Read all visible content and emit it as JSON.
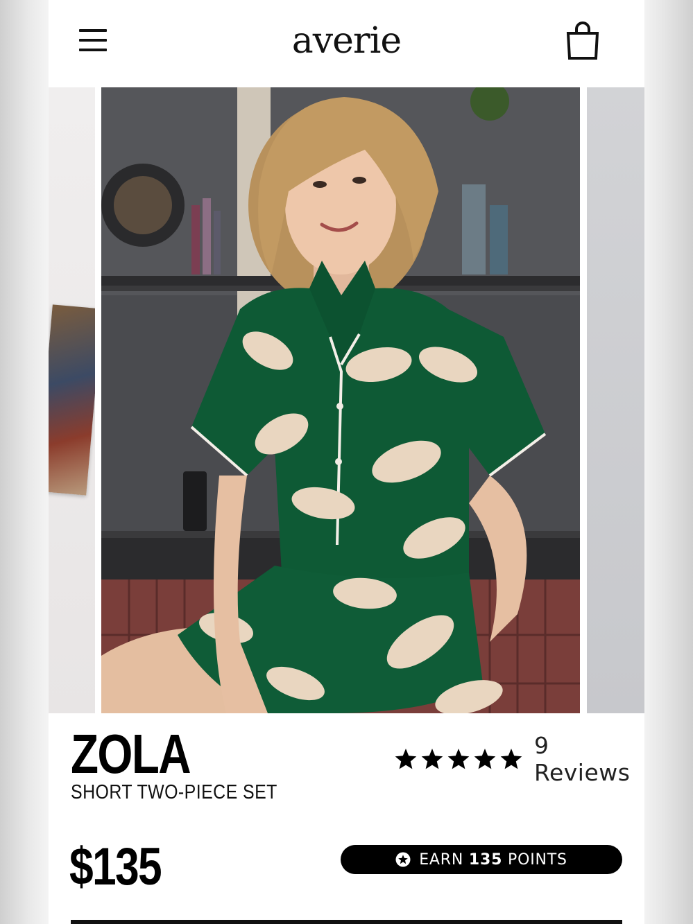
{
  "header": {
    "logo_text": "averie",
    "menu_icon": "hamburger-menu-icon",
    "cart_icon": "shopping-bag-icon"
  },
  "carousel": {
    "current_image": "Model wearing green satin tiger-print short pajama set"
  },
  "product": {
    "name": "ZOLA",
    "subtitle": "SHORT TWO-PIECE SET",
    "rating_stars": 5,
    "reviews_label": "9 Reviews",
    "price": "$135",
    "points": {
      "prefix": "EARN",
      "amount": "135",
      "suffix": "POINTS",
      "icon": "star-badge-icon"
    }
  },
  "colors": {
    "pajama_green": "#0e5a35",
    "tiger_cream": "#e9d6c0",
    "wall_gray": "#4b4c50",
    "pill_black": "#000000"
  }
}
